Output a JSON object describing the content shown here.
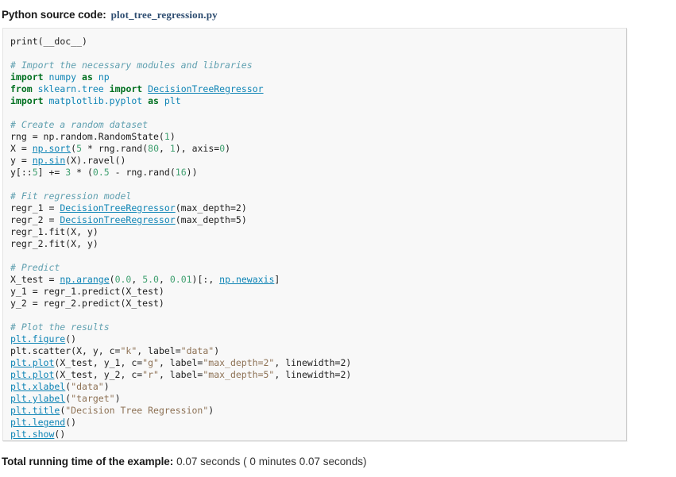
{
  "header": {
    "label": "Python source code:",
    "filename": "plot_tree_regression.py"
  },
  "footer": {
    "label": "Total running time of the example:",
    "value": "0.07 seconds ( 0 minutes 0.07 seconds)"
  },
  "code": {
    "language": "python",
    "lines": [
      [
        {
          "t": "print",
          "c": "plain"
        },
        {
          "t": "(__doc__)",
          "c": "plain"
        }
      ],
      [],
      [
        {
          "t": "# Import the necessary modules and libraries",
          "c": "comment"
        }
      ],
      [
        {
          "t": "import",
          "c": "kw"
        },
        {
          "t": " ",
          "c": "plain"
        },
        {
          "t": "numpy",
          "c": "name"
        },
        {
          "t": " ",
          "c": "plain"
        },
        {
          "t": "as",
          "c": "kw"
        },
        {
          "t": " ",
          "c": "plain"
        },
        {
          "t": "np",
          "c": "name"
        }
      ],
      [
        {
          "t": "from",
          "c": "kw"
        },
        {
          "t": " ",
          "c": "plain"
        },
        {
          "t": "sklearn.tree",
          "c": "name"
        },
        {
          "t": " ",
          "c": "plain"
        },
        {
          "t": "import",
          "c": "kw"
        },
        {
          "t": " ",
          "c": "plain"
        },
        {
          "t": "DecisionTreeRegressor",
          "c": "link"
        }
      ],
      [
        {
          "t": "import",
          "c": "kw"
        },
        {
          "t": " ",
          "c": "plain"
        },
        {
          "t": "matplotlib.pyplot",
          "c": "name"
        },
        {
          "t": " ",
          "c": "plain"
        },
        {
          "t": "as",
          "c": "kw"
        },
        {
          "t": " ",
          "c": "plain"
        },
        {
          "t": "plt",
          "c": "name"
        }
      ],
      [],
      [
        {
          "t": "# Create a random dataset",
          "c": "comment"
        }
      ],
      [
        {
          "t": "rng = np.random.RandomState(",
          "c": "plain"
        },
        {
          "t": "1",
          "c": "num"
        },
        {
          "t": ")",
          "c": "plain"
        }
      ],
      [
        {
          "t": "X = ",
          "c": "plain"
        },
        {
          "t": "np.sort",
          "c": "link"
        },
        {
          "t": "(",
          "c": "plain"
        },
        {
          "t": "5",
          "c": "num"
        },
        {
          "t": " * rng.rand(",
          "c": "plain"
        },
        {
          "t": "80",
          "c": "num"
        },
        {
          "t": ", ",
          "c": "plain"
        },
        {
          "t": "1",
          "c": "num"
        },
        {
          "t": "), axis=",
          "c": "plain"
        },
        {
          "t": "0",
          "c": "num"
        },
        {
          "t": ")",
          "c": "plain"
        }
      ],
      [
        {
          "t": "y = ",
          "c": "plain"
        },
        {
          "t": "np.sin",
          "c": "link"
        },
        {
          "t": "(X).ravel()",
          "c": "plain"
        }
      ],
      [
        {
          "t": "y[::",
          "c": "plain"
        },
        {
          "t": "5",
          "c": "num"
        },
        {
          "t": "] += ",
          "c": "plain"
        },
        {
          "t": "3",
          "c": "num"
        },
        {
          "t": " * (",
          "c": "plain"
        },
        {
          "t": "0.5",
          "c": "num"
        },
        {
          "t": " - rng.rand(",
          "c": "plain"
        },
        {
          "t": "16",
          "c": "num"
        },
        {
          "t": "))",
          "c": "plain"
        }
      ],
      [],
      [
        {
          "t": "# Fit regression model",
          "c": "comment"
        }
      ],
      [
        {
          "t": "regr_1 = ",
          "c": "plain"
        },
        {
          "t": "DecisionTreeRegressor",
          "c": "link"
        },
        {
          "t": "(max_depth=",
          "c": "plain"
        },
        {
          "t": "2",
          "c": "plain"
        },
        {
          "t": ")",
          "c": "plain"
        }
      ],
      [
        {
          "t": "regr_2 = ",
          "c": "plain"
        },
        {
          "t": "DecisionTreeRegressor",
          "c": "link"
        },
        {
          "t": "(max_depth=",
          "c": "plain"
        },
        {
          "t": "5",
          "c": "plain"
        },
        {
          "t": ")",
          "c": "plain"
        }
      ],
      [
        {
          "t": "regr_1.fit(X, y)",
          "c": "plain"
        }
      ],
      [
        {
          "t": "regr_2.fit(X, y)",
          "c": "plain"
        }
      ],
      [],
      [
        {
          "t": "# Predict",
          "c": "comment"
        }
      ],
      [
        {
          "t": "X_test = ",
          "c": "plain"
        },
        {
          "t": "np.arange",
          "c": "link"
        },
        {
          "t": "(",
          "c": "plain"
        },
        {
          "t": "0.0",
          "c": "num"
        },
        {
          "t": ", ",
          "c": "plain"
        },
        {
          "t": "5.0",
          "c": "num"
        },
        {
          "t": ", ",
          "c": "plain"
        },
        {
          "t": "0.01",
          "c": "num"
        },
        {
          "t": ")[:, ",
          "c": "plain"
        },
        {
          "t": "np.newaxis",
          "c": "link"
        },
        {
          "t": "]",
          "c": "plain"
        }
      ],
      [
        {
          "t": "y_1 = regr_1.predict(X_test)",
          "c": "plain"
        }
      ],
      [
        {
          "t": "y_2 = regr_2.predict(X_test)",
          "c": "plain"
        }
      ],
      [],
      [
        {
          "t": "# Plot the results",
          "c": "comment"
        }
      ],
      [
        {
          "t": "plt.figure",
          "c": "link"
        },
        {
          "t": "()",
          "c": "plain"
        }
      ],
      [
        {
          "t": "plt.scatter(X, y, c=",
          "c": "plain"
        },
        {
          "t": "\"k\"",
          "c": "strlit"
        },
        {
          "t": ", label=",
          "c": "plain"
        },
        {
          "t": "\"data\"",
          "c": "strlit"
        },
        {
          "t": ")",
          "c": "plain"
        }
      ],
      [
        {
          "t": "plt.plot",
          "c": "link"
        },
        {
          "t": "(X_test, y_1, c=",
          "c": "plain"
        },
        {
          "t": "\"g\"",
          "c": "strlit"
        },
        {
          "t": ", label=",
          "c": "plain"
        },
        {
          "t": "\"max_depth=2\"",
          "c": "strlit"
        },
        {
          "t": ", linewidth=",
          "c": "plain"
        },
        {
          "t": "2",
          "c": "plain"
        },
        {
          "t": ")",
          "c": "plain"
        }
      ],
      [
        {
          "t": "plt.plot",
          "c": "link"
        },
        {
          "t": "(X_test, y_2, c=",
          "c": "plain"
        },
        {
          "t": "\"r\"",
          "c": "strlit"
        },
        {
          "t": ", label=",
          "c": "plain"
        },
        {
          "t": "\"max_depth=5\"",
          "c": "strlit"
        },
        {
          "t": ", linewidth=",
          "c": "plain"
        },
        {
          "t": "2",
          "c": "plain"
        },
        {
          "t": ")",
          "c": "plain"
        }
      ],
      [
        {
          "t": "plt.xlabel",
          "c": "link"
        },
        {
          "t": "(",
          "c": "plain"
        },
        {
          "t": "\"data\"",
          "c": "strlit"
        },
        {
          "t": ")",
          "c": "plain"
        }
      ],
      [
        {
          "t": "plt.ylabel",
          "c": "link"
        },
        {
          "t": "(",
          "c": "plain"
        },
        {
          "t": "\"target\"",
          "c": "strlit"
        },
        {
          "t": ")",
          "c": "plain"
        }
      ],
      [
        {
          "t": "plt.title",
          "c": "link"
        },
        {
          "t": "(",
          "c": "plain"
        },
        {
          "t": "\"Decision Tree Regression\"",
          "c": "strlit"
        },
        {
          "t": ")",
          "c": "plain"
        }
      ],
      [
        {
          "t": "plt.legend",
          "c": "link"
        },
        {
          "t": "()",
          "c": "plain"
        }
      ],
      [
        {
          "t": "plt.show",
          "c": "link"
        },
        {
          "t": "()",
          "c": "plain"
        }
      ]
    ]
  }
}
